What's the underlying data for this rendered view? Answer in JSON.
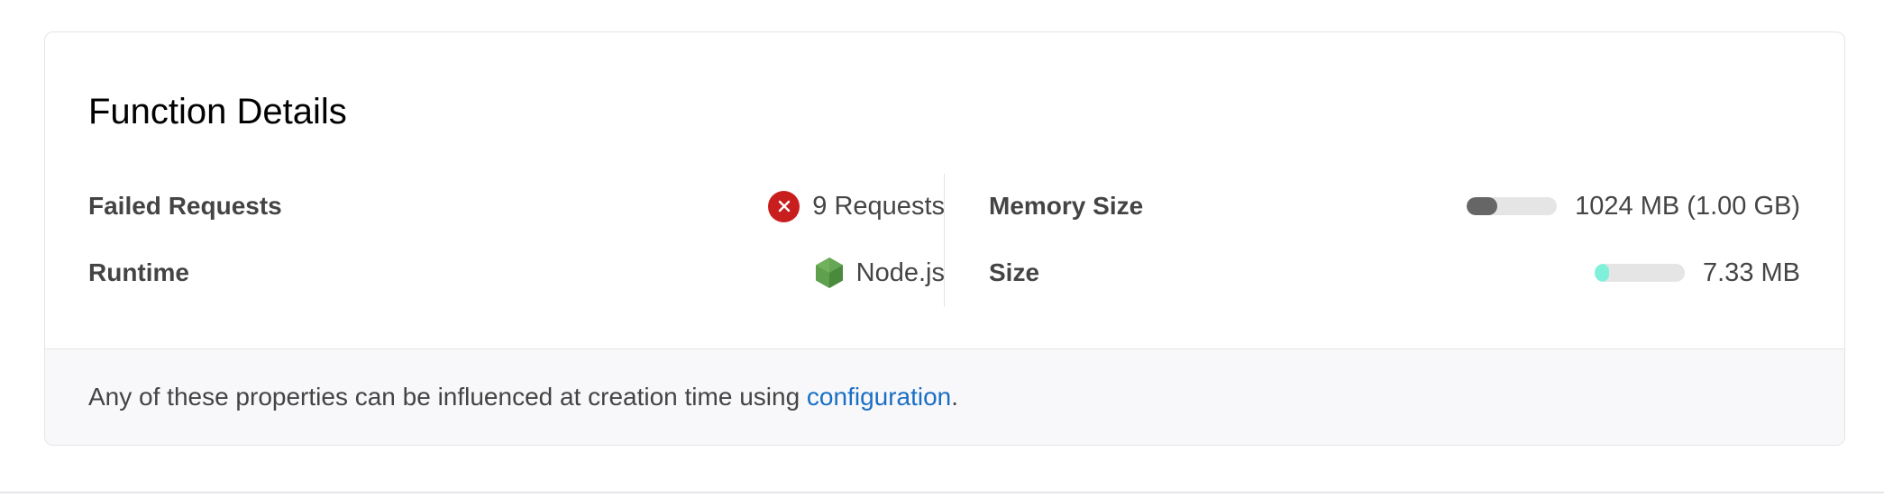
{
  "card": {
    "title": "Function Details"
  },
  "details": {
    "failed_requests": {
      "label": "Failed Requests",
      "value": "9 Requests",
      "icon": "error-x-icon",
      "icon_color": "#c81e1e"
    },
    "runtime": {
      "label": "Runtime",
      "value": "Node.js",
      "icon": "nodejs-icon",
      "icon_color": "#5fa04e"
    },
    "memory_size": {
      "label": "Memory Size",
      "value": "1024 MB (1.00 GB)",
      "usage_fraction": 0.34,
      "bar_color": "#666666"
    },
    "size": {
      "label": "Size",
      "value": "7.33 MB",
      "usage_fraction": 0.16,
      "bar_color": "#7ff0d9"
    }
  },
  "footer": {
    "text_before": "Any of these properties can be influenced at creation time using ",
    "link_text": "configuration",
    "text_after": "."
  }
}
